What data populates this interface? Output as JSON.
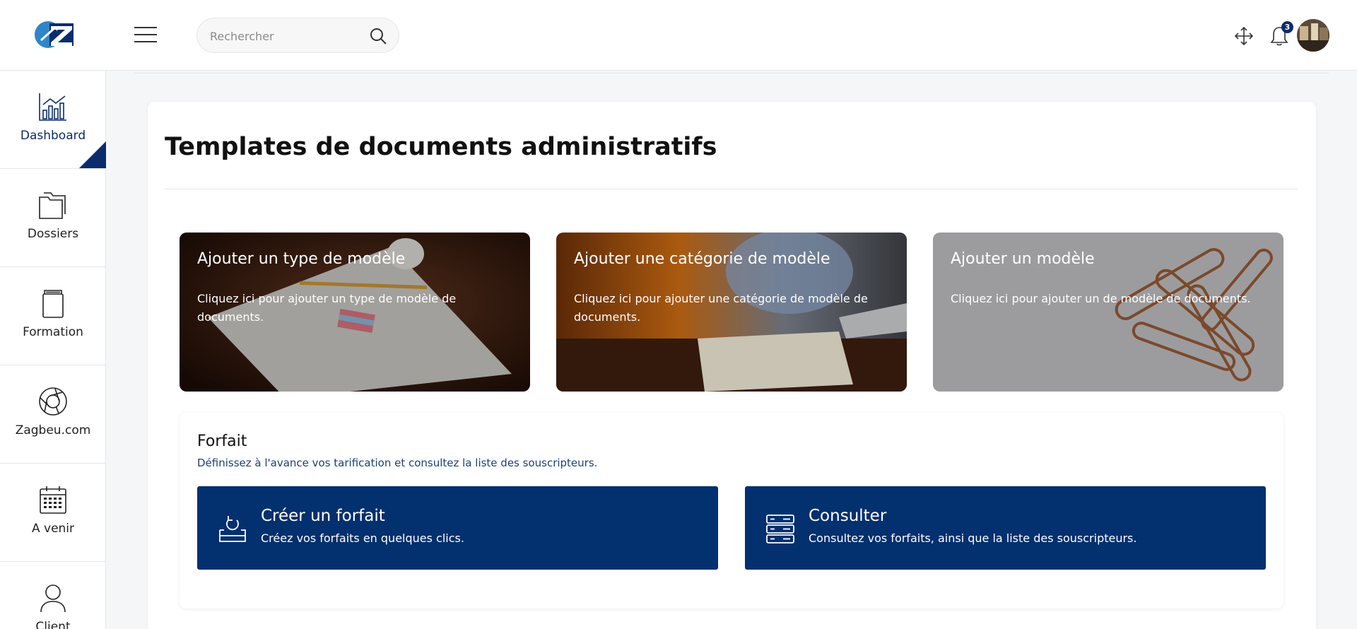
{
  "header": {
    "search_placeholder": "Rechercher",
    "notification_count": "3",
    "icons": [
      "logo",
      "menu-icon",
      "search-icon",
      "expand-arrows-icon",
      "bell-icon",
      "user-avatar"
    ]
  },
  "sidebar": {
    "items": [
      {
        "label": "Dashboard",
        "icon": "chart-icon",
        "active": true
      },
      {
        "label": "Dossiers",
        "icon": "folder-icon"
      },
      {
        "label": "Formation",
        "icon": "book-icon"
      },
      {
        "label": "Zagbeu.com",
        "icon": "aperture-icon"
      },
      {
        "label": "A venir",
        "icon": "calendar-icon"
      },
      {
        "label": "Client",
        "icon": "user-icon"
      }
    ]
  },
  "main": {
    "title": "Templates de documents administratifs",
    "tiles": [
      {
        "title": "Ajouter un type de modèle",
        "desc": "Cliquez ici pour ajouter un type de modèle de documents."
      },
      {
        "title": "Ajouter une catégorie de modèle",
        "desc": "Cliquez ici pour ajouter une catégorie de modèle de documents."
      },
      {
        "title": "Ajouter un modèle",
        "desc": "Cliquez ici pour ajouter un de modèle de documents."
      }
    ],
    "forfait": {
      "title": "Forfait",
      "subtitle": "Définissez à l'avance vos tarification et consultez la liste des souscripteurs.",
      "buttons": [
        {
          "title": "Créer un forfait",
          "desc": "Créez vos forfaits en quelques clics."
        },
        {
          "title": "Consulter",
          "desc": "Consultez vos forfaits, ainsi que la liste des souscripteurs."
        }
      ]
    }
  },
  "colors": {
    "brand": "#03306f",
    "accent": "#0a2c6d",
    "background": "#f5f6f8"
  }
}
